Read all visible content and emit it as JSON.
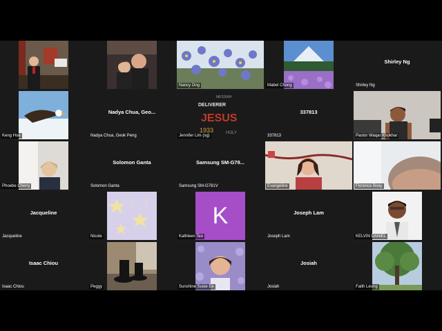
{
  "participants": [
    {
      "name": "",
      "type": "video",
      "video": "church"
    },
    {
      "name": "",
      "type": "video",
      "video": "couple"
    },
    {
      "name": "Nancy Ong",
      "type": "video",
      "video": "flowers"
    },
    {
      "name": "Mabel Chong",
      "type": "video",
      "video": "mountain"
    },
    {
      "name": "Shirley Ng",
      "type": "name",
      "display": "Shirley Ng"
    },
    {
      "name": "Keng Hoe",
      "type": "video",
      "video": "eagle"
    },
    {
      "name": "Nadya Chua, Geok Peng",
      "type": "name",
      "display": "Nadya Chua, Geo..."
    },
    {
      "name": "Jennifer Lim (sg)",
      "type": "video",
      "video": "wordart"
    },
    {
      "name": "337813",
      "type": "name",
      "display": "337813"
    },
    {
      "name": "Pastor Waqar Khokhar",
      "type": "video",
      "video": "boy"
    },
    {
      "name": "Phoebe Cherry",
      "type": "video",
      "video": "lady"
    },
    {
      "name": "Solomon Ganta",
      "type": "name",
      "display": "Solomon Ganta"
    },
    {
      "name": "Samsung SM-G781V",
      "type": "name",
      "display": "Samsung SM-G78..."
    },
    {
      "name": "Evangeline",
      "type": "video",
      "video": "woman"
    },
    {
      "name": "Florence Boey",
      "type": "video",
      "video": "closeup"
    },
    {
      "name": "Jacqueline",
      "type": "name",
      "display": "Jacqueline"
    },
    {
      "name": "Nicole",
      "type": "video",
      "video": "stars"
    },
    {
      "name": "Kathleen Teo",
      "type": "avatar",
      "initial": "K"
    },
    {
      "name": "Joseph Lam",
      "type": "name",
      "display": "Joseph Lam"
    },
    {
      "name": "KELVIN DANIEL",
      "type": "video",
      "video": "man"
    },
    {
      "name": "Isaac Chiou",
      "type": "name",
      "display": "Isaac Chiou"
    },
    {
      "name": "Peggy",
      "type": "video",
      "video": "shoes"
    },
    {
      "name": "Sunshine Susie Ee",
      "type": "video",
      "video": "susie"
    },
    {
      "name": "Josiah",
      "type": "name",
      "display": "Josiah"
    },
    {
      "name": "Faith Leong",
      "type": "video",
      "video": "tree"
    }
  ],
  "avatar_color": "#a64ec7",
  "word_art_text": [
    "MESSIAH",
    "DELIVERER",
    "JESUS",
    "1933",
    "HOLY"
  ]
}
